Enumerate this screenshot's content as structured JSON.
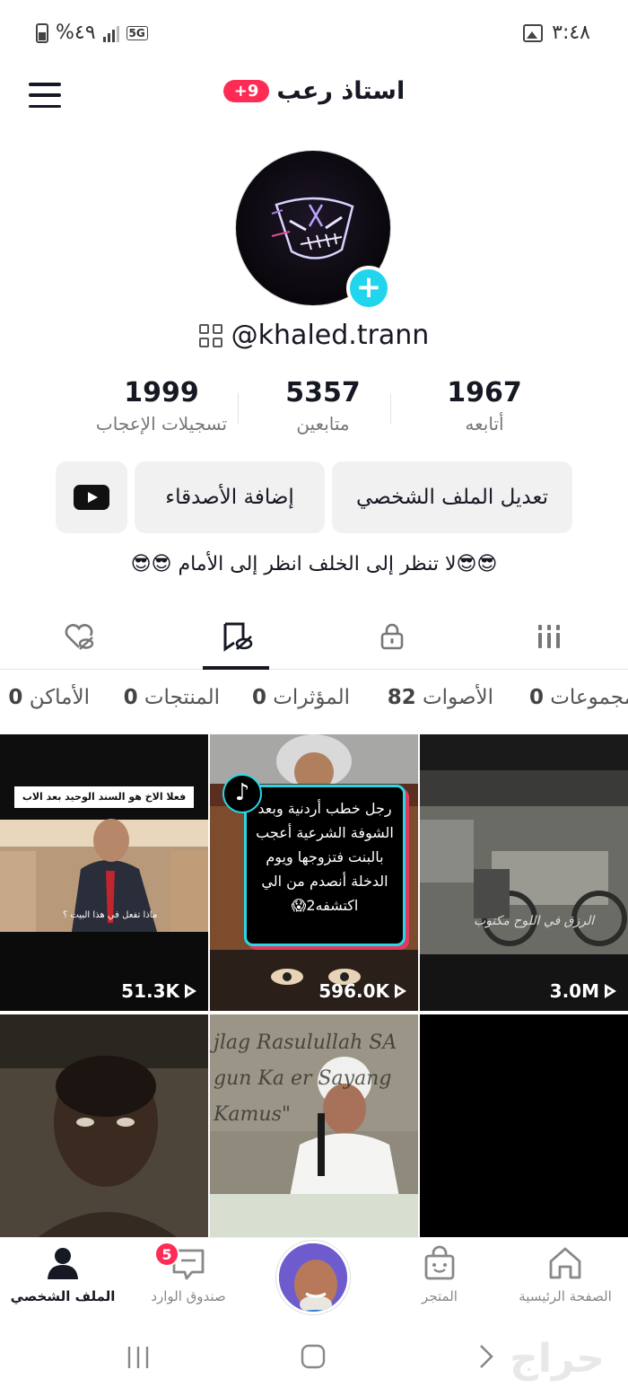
{
  "status_bar": {
    "time": "٣:٤٨",
    "battery": "%٤٩",
    "network": "5G"
  },
  "header": {
    "title": "استاذ رعب",
    "badge": "+9"
  },
  "profile": {
    "username": "@khaled.trann"
  },
  "stats": [
    {
      "value": "1967",
      "label": "أتابعه"
    },
    {
      "value": "5357",
      "label": "متابعين"
    },
    {
      "value": "1999",
      "label": "تسجيلات الإعجاب"
    }
  ],
  "buttons": {
    "edit_profile": "تعديل الملف الشخصي",
    "add_friends": "إضافة الأصدقاء"
  },
  "bio": "😎😎لا تنظر إلى الخلف انظر إلى الأمام 😎😎",
  "filter_chips": [
    {
      "label": "مجموعات",
      "count": "0"
    },
    {
      "label": "الأصوات",
      "count": "82"
    },
    {
      "label": "المؤثرات",
      "count": "0"
    },
    {
      "label": "المنتجات",
      "count": "0"
    },
    {
      "label": "الأماكن",
      "count": "0"
    }
  ],
  "videos": [
    {
      "views": "3.0M",
      "caption": "الرزق في اللوح مكتوب"
    },
    {
      "views": "596.0K",
      "caption": "رجل خطب أردنية وبعد الشوفة الشرعية أعجب بالبنت فتزوجها ويوم الدخلة أنصدم من الي اكتشفه2😱"
    },
    {
      "views": "51.3K",
      "caption": "فعلا الاخ هو السند الوحيد  بعد الاب",
      "subcaption": "ماذا تفعل في هذا البيت ؟"
    },
    {
      "views": "",
      "caption": ""
    },
    {
      "views": "",
      "caption": "jlag Rasulullah SA gun Ka er Sayang Kamus\""
    },
    {
      "views": "",
      "caption": ""
    }
  ],
  "bottom_nav": [
    {
      "label": "الصفحة الرئيسية"
    },
    {
      "label": "المتجر"
    },
    {
      "label": ""
    },
    {
      "label": "صندوق الوارد",
      "badge": "5"
    },
    {
      "label": "الملف الشخصي"
    }
  ],
  "watermark": "حراج"
}
